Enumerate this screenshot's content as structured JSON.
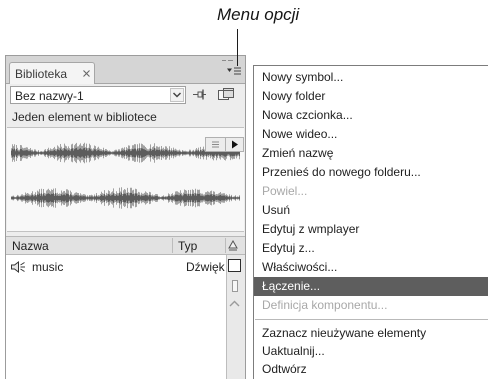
{
  "annotation": {
    "label": "Menu opcji"
  },
  "library_panel": {
    "tab": {
      "label": "Biblioteka"
    },
    "library_select": {
      "value": "Bez nazwy-1"
    },
    "status_text": "Jeden element w bibliotece",
    "columns": {
      "name": "Nazwa",
      "type": "Typ"
    },
    "items": [
      {
        "name": "music",
        "type": "Dźwięk"
      }
    ]
  },
  "options_menu": {
    "groups": [
      [
        {
          "label": "Nowy symbol...",
          "disabled": false,
          "highlighted": false
        },
        {
          "label": "Nowy folder",
          "disabled": false,
          "highlighted": false
        },
        {
          "label": "Nowa czcionka...",
          "disabled": false,
          "highlighted": false
        },
        {
          "label": "Nowe wideo...",
          "disabled": false,
          "highlighted": false
        },
        {
          "label": "Zmień nazwę",
          "disabled": false,
          "highlighted": false
        },
        {
          "label": "Przenieś do nowego folderu...",
          "disabled": false,
          "highlighted": false
        },
        {
          "label": "Powiel...",
          "disabled": true,
          "highlighted": false
        },
        {
          "label": "Usuń",
          "disabled": false,
          "highlighted": false
        },
        {
          "label": "Edytuj z wmplayer",
          "disabled": false,
          "highlighted": false
        },
        {
          "label": "Edytuj z...",
          "disabled": false,
          "highlighted": false
        },
        {
          "label": "Właściwości...",
          "disabled": false,
          "highlighted": false
        },
        {
          "label": "Łączenie...",
          "disabled": false,
          "highlighted": true
        },
        {
          "label": "Definicja komponentu...",
          "disabled": true,
          "highlighted": false
        }
      ],
      [
        {
          "label": "Zaznacz nieużywane elementy",
          "disabled": false,
          "highlighted": false
        },
        {
          "label": "Uaktualnij...",
          "disabled": false,
          "highlighted": false
        },
        {
          "label": "Odtwórz",
          "disabled": false,
          "highlighted": false
        }
      ]
    ]
  },
  "icons": {
    "tab_close": "close-icon",
    "panel_collapse": "collapse-panel-icon",
    "panel_menu": "panel-menu-icon",
    "select_arrow": "chevron-down-icon",
    "pin": "pin-icon",
    "new_library_panel": "new-library-panel-icon",
    "preview_stop": "stop-icon",
    "preview_play": "play-icon",
    "sort_toggle": "sort-icon",
    "item_type": "speaker-icon",
    "wide_view": "wide-view-icon",
    "narrow_view": "narrow-view-icon",
    "scroll_up": "chevron-up-icon"
  },
  "colors": {
    "menu_highlight_background": "#5e5e5e",
    "menu_highlight_text": "#ffffff",
    "menu_disabled_text": "#a8a8a8"
  }
}
